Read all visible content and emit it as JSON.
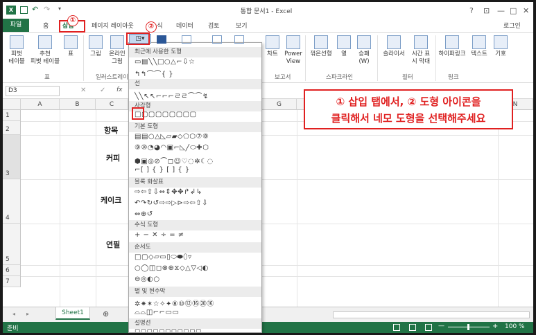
{
  "title": "통합 문서1 - Excel",
  "window": {
    "help": "?",
    "ribbon_opts": "⊡",
    "minimize": "—",
    "maximize": "□",
    "close": "✕",
    "login": "로그인"
  },
  "tabs": [
    "파일",
    "홈",
    "삽입",
    "페이지 레이아웃",
    "수식",
    "데이터",
    "검토",
    "보기"
  ],
  "ribbon": {
    "pivot": "피벗\n테이블",
    "recpivot": "추천\n피벗 테이블",
    "table": "표",
    "picture": "그림",
    "online": "온라인\n그림",
    "chart": "차트",
    "power": "Power\nView",
    "line": "꺾은선형",
    "col": "열",
    "winloss": "승패\n(W)",
    "slicer": "슬라이서",
    "timeline": "시간 표\n시 막대",
    "hyperlink": "하이퍼링크",
    "text": "텍스트",
    "symbol": "기호",
    "groups": {
      "table": "표",
      "illus": "일러스트레이",
      "report": "보고서",
      "spark": "스파크라인",
      "filter": "필터",
      "link": "링크"
    }
  },
  "formula": {
    "namebox": "D3",
    "fx": "fx"
  },
  "columns": [
    "A",
    "B",
    "C",
    "G",
    "H",
    "N"
  ],
  "rows": [
    "1",
    "2",
    "3",
    "4",
    "5",
    "6",
    "7"
  ],
  "cells": {
    "c2": "항목",
    "c3": "커피",
    "c4": "케이크",
    "c5": "연필"
  },
  "sheet": {
    "tab": "Sheet1",
    "add": "⊕"
  },
  "status": {
    "ready": "준비",
    "zoom": "100 %",
    "minus": "—",
    "plus": "+"
  },
  "dropdown": {
    "sections": [
      "최근에 사용한 도형",
      "선",
      "사각형",
      "기본 도형",
      "블록 화살표",
      "수식 도형",
      "순서도",
      "별 및 현수막",
      "설명선"
    ],
    "recent_shapes": "▭▤╲╲□○△⌐⇩☆",
    "recent_shapes2": "↰↰⌒⌒{ }",
    "line_shapes": "╲╲↖↖⌐⌐⌐ㄹㄹ⌒⌒↯",
    "rect_shapes": "□▢▢▢▢▢▢▢▢",
    "basic1": "▤▤○△◺▱▰◇⬠⬡⑦⑧",
    "basic2": "⑨⑩◔◕◠▣⌐◺╱⬭✚⬡",
    "basic3": "⬢▣◎⊘⌒◻☺♡◌✲☾◌",
    "basic4": "⌐[ ] { } [ ] { }",
    "arrow1": "⇨⇦⇧⇩⇔⇕✥✥↱↲↳",
    "arrow2": "↶↷↻↺⇨⇨▷⊳⇨⇦⇧⇩",
    "arrow3": "⇔⊕↺",
    "eq1": "+ − ✕ ÷ = ≠",
    "flow1": "□▢◇▱▭▯⬭⬬⬯▿",
    "flow2": "○◯◫◻⊗⊕⧖◇△▽◁◐",
    "flow3": "⊖◎◐○",
    "star1": "✲✷✶☆✧✦⑧⑩⑫⑯⑳⑯",
    "star2": "⌓⌓◫⌐⌐▭▭",
    "callout1": "◻◻◻◻◻◻◻◻◻◻◻"
  },
  "markers": {
    "one": "①",
    "two": "②"
  },
  "annotation": {
    "line1": "① 삽입 탭에서,  ② 도형 아이콘을",
    "line2": "클릭해서 네모 도형을 선택해주세요"
  },
  "colors": {
    "excel_green": "#217346",
    "marker_red": "#e02020"
  }
}
